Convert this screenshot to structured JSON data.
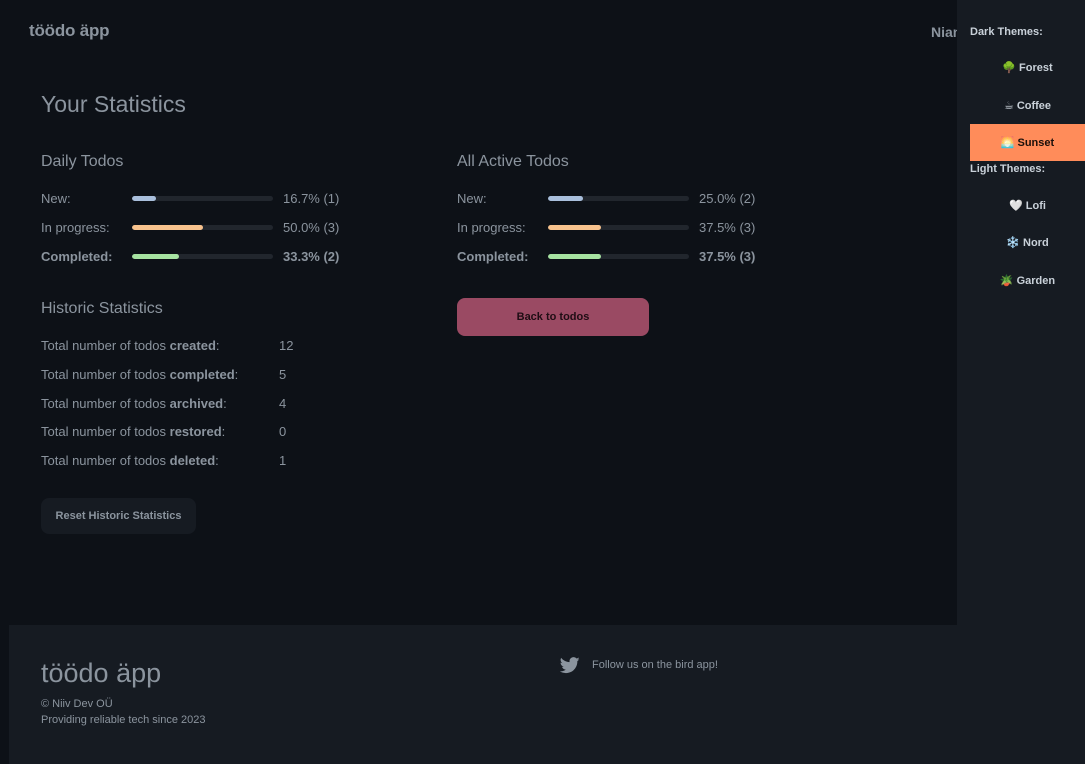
{
  "header": {
    "brand": "töödo äpp",
    "user_name": "Niam"
  },
  "page_title": "Your Statistics",
  "daily": {
    "title": "Daily Todos",
    "rows": [
      {
        "label": "New:",
        "percent": 16.7,
        "pct_text": "16.7% (1)",
        "color": "#a9bfdc"
      },
      {
        "label": "In progress:",
        "percent": 50.0,
        "pct_text": "50.0% (3)",
        "color": "#f7c28d"
      },
      {
        "label": "Completed:",
        "percent": 33.3,
        "pct_text": "33.3% (2)",
        "color": "#a6e3a1"
      }
    ]
  },
  "active": {
    "title": "All Active Todos",
    "rows": [
      {
        "label": "New:",
        "percent": 25.0,
        "pct_text": "25.0% (2)",
        "color": "#a9bfdc"
      },
      {
        "label": "In progress:",
        "percent": 37.5,
        "pct_text": "37.5% (3)",
        "color": "#f7c28d"
      },
      {
        "label": "Completed:",
        "percent": 37.5,
        "pct_text": "37.5% (3)",
        "color": "#a6e3a1"
      }
    ]
  },
  "historic": {
    "title": "Historic Statistics",
    "prefix": "Total number of todos ",
    "rows": [
      {
        "word": "created",
        "value": "12"
      },
      {
        "word": "completed",
        "value": "5"
      },
      {
        "word": "archived",
        "value": "4"
      },
      {
        "word": "restored",
        "value": "0"
      },
      {
        "word": "deleted",
        "value": "1"
      }
    ],
    "suffix": ":"
  },
  "buttons": {
    "reset": "Reset Historic Statistics",
    "back": "Back to todos"
  },
  "footer": {
    "brand": "töödo äpp",
    "copyright": "© Niiv Dev OÜ",
    "tagline": "Providing reliable tech since 2023",
    "follow": "Follow us on the bird app!"
  },
  "themes": {
    "dark_heading": "Dark Themes:",
    "light_heading": "Light Themes:",
    "dark": [
      {
        "emoji": "🌳",
        "label": "Forest",
        "active": false
      },
      {
        "emoji": "☕",
        "label": "Coffee",
        "active": false
      },
      {
        "emoji": "🌅",
        "label": "Sunset",
        "active": true
      }
    ],
    "light": [
      {
        "emoji": "🤍",
        "label": "Lofi",
        "active": false
      },
      {
        "emoji": "❄️",
        "label": "Nord",
        "active": false
      },
      {
        "emoji": "🪴",
        "label": "Garden",
        "active": false
      }
    ]
  },
  "accent_colors": {
    "sunset": "#ff8c5a",
    "back_button": "#9a4a63"
  }
}
